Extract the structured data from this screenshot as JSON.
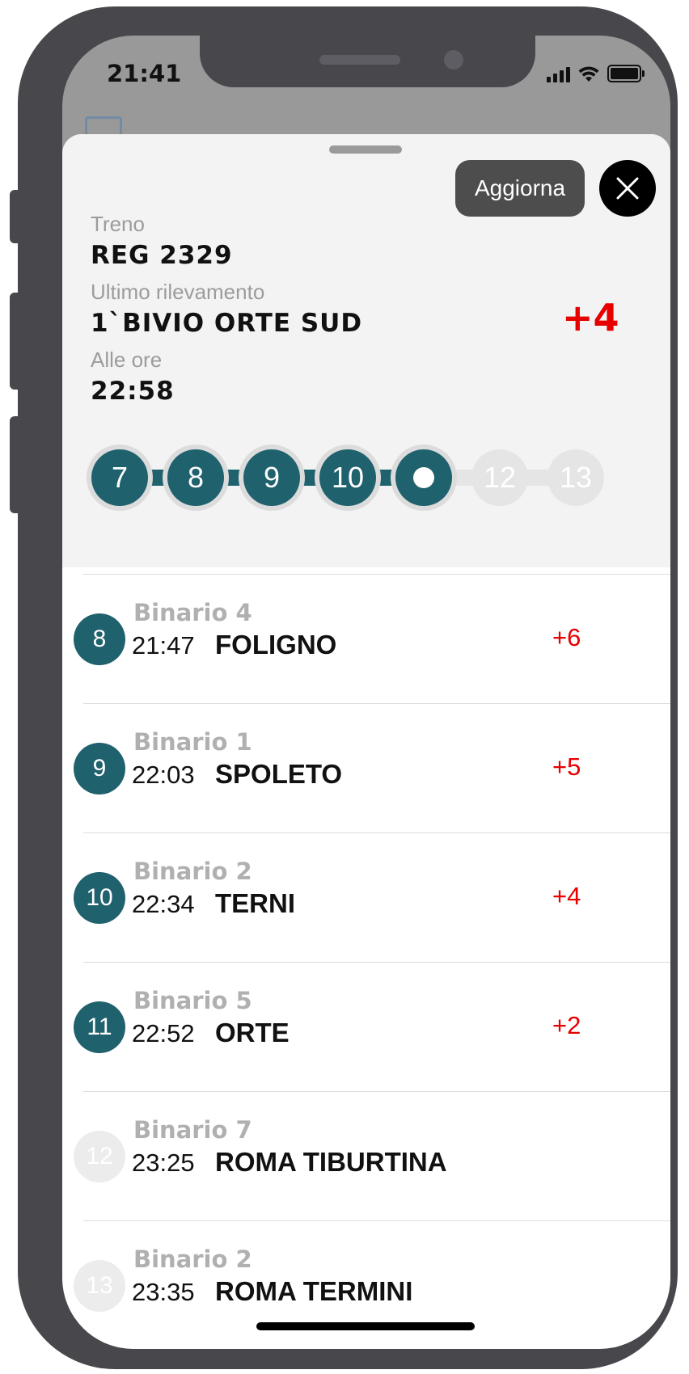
{
  "status_bar": {
    "time": "21:41"
  },
  "sheet": {
    "refresh_label": "Aggiorna",
    "train_label": "Treno",
    "train_value": "REG 2329",
    "last_label": "Ultimo rilevamento",
    "last_value": "1`BIVIO ORTE SUD",
    "time_label": "Alle ore",
    "time_value": "22:58",
    "delay": "+4"
  },
  "progress": {
    "stops": [
      "7",
      "8",
      "9",
      "10",
      "",
      "12",
      "13"
    ],
    "current_index": 4
  },
  "stops": [
    {
      "num": "8",
      "platform": "Binario 4",
      "time": "21:47",
      "station": "FOLIGNO",
      "delay": "+6"
    },
    {
      "num": "9",
      "platform": "Binario 1",
      "time": "22:03",
      "station": "SPOLETO",
      "delay": "+5"
    },
    {
      "num": "10",
      "platform": "Binario 2",
      "time": "22:34",
      "station": "TERNI",
      "delay": "+4"
    },
    {
      "num": "11",
      "platform": "Binario 5",
      "time": "22:52",
      "station": "ORTE",
      "delay": "+2"
    },
    {
      "num": "12",
      "platform": "Binario 7",
      "time": "23:25",
      "station": "ROMA TIBURTINA",
      "delay": ""
    },
    {
      "num": "13",
      "platform": "Binario 2",
      "time": "23:35",
      "station": "ROMA TERMINI",
      "delay": ""
    }
  ],
  "colors": {
    "accent": "#20616e",
    "delay": "#e60000"
  },
  "icons": {
    "close": "close-icon",
    "signal": "signal-icon",
    "wifi": "wifi-icon",
    "battery": "battery-icon"
  }
}
